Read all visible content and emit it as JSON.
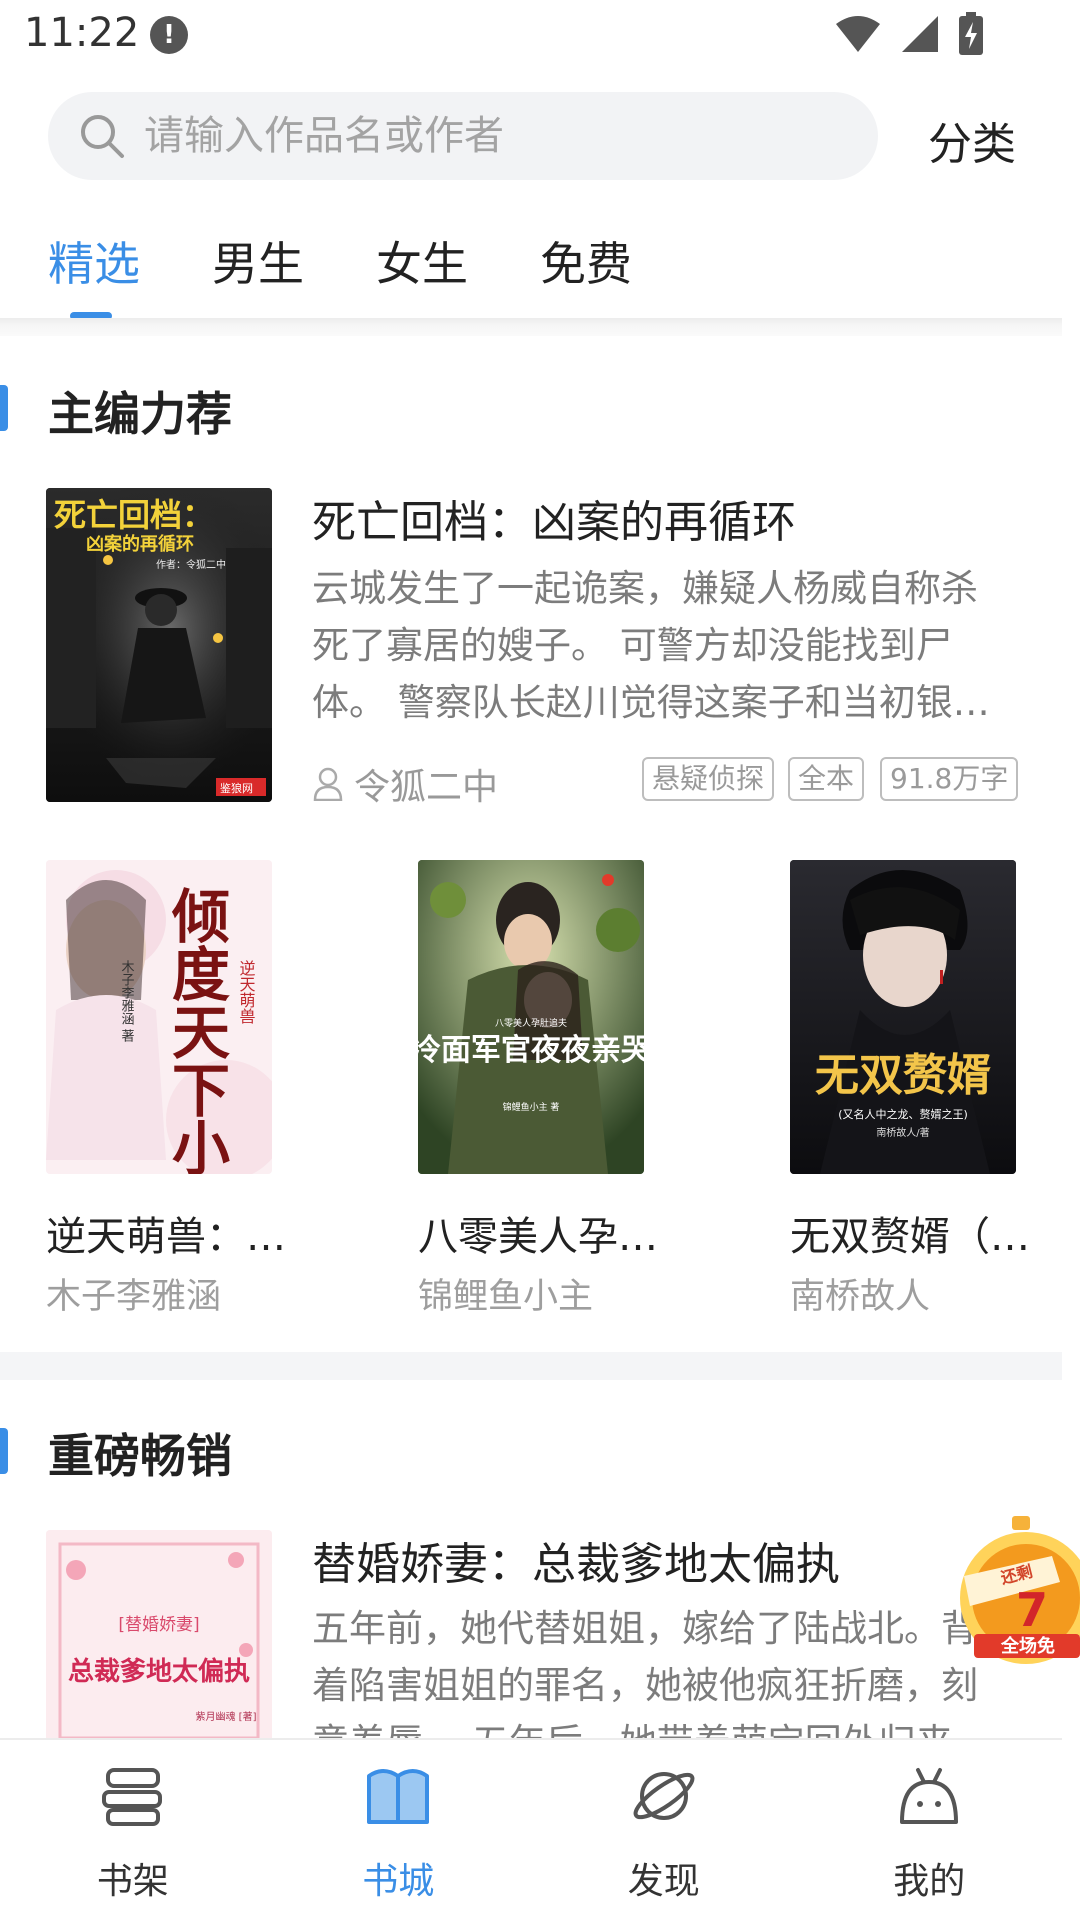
{
  "status_bar": {
    "time": "11:22",
    "alert": "!"
  },
  "search": {
    "placeholder": "请输入作品名或作者",
    "category_label": "分类"
  },
  "tabs": [
    {
      "label": "精选",
      "active": true
    },
    {
      "label": "男生",
      "active": false
    },
    {
      "label": "女生",
      "active": false
    },
    {
      "label": "免费",
      "active": false
    }
  ],
  "section_editor": {
    "title": "主编力荐",
    "featured": {
      "cover_title": "死亡回档：",
      "cover_subtitle": "凶案的再循环",
      "cover_author_line": "作者：令狐二中",
      "cover_logo": "鉴狼网",
      "title": "死亡回档：凶案的再循环",
      "description": "云城发生了一起诡案，嫌疑人杨威自称杀死了寡居的嫂子。 可警方却没能找到尸体。 警察队长赵川觉得这案子和当初银…",
      "author": "令狐二中",
      "tags": [
        "悬疑侦探",
        "全本",
        "91.8万字"
      ]
    },
    "grid": [
      {
        "title": "逆天萌兽：…",
        "author": "木子李雅涵",
        "cover_text": "倾度天下小姐",
        "cover_vertical": "逆天萌兽",
        "cover_author": "木子李雅涵 著"
      },
      {
        "title": "八零美人孕…",
        "author": "锦鲤鱼小主",
        "cover_text": "冷面军官夜夜亲哭",
        "cover_small": "八零美人孕肚追夫",
        "cover_author": "锦鲤鱼小主 著"
      },
      {
        "title": "无双赘婿（…",
        "author": "南桥故人",
        "cover_text": "无双赘婿",
        "cover_sub": "(又名人中之龙、赘婿之王)",
        "cover_author": "南桥故人/著"
      }
    ]
  },
  "section_bestseller": {
    "title": "重磅畅销",
    "item": {
      "title": "替婚娇妻：总裁爹地太偏执",
      "description": "五年前，她代替姐姐，嫁给了陆战北。背着陷害姐姐的罪名，她被他疯狂折磨，刻意羞辱。 五年后，她带着萌宝回外归来",
      "cover_tag": "[替婚娇妻]",
      "cover_text": "总裁爹地太偏执",
      "cover_author": "紫月幽魂 [著]"
    }
  },
  "promo": {
    "top_label": "还剩",
    "number": "7",
    "bottom_label": "全场免"
  },
  "bottom_nav": [
    {
      "label": "书架",
      "icon": "bookshelf-icon",
      "active": false
    },
    {
      "label": "书城",
      "icon": "book-open-icon",
      "active": true
    },
    {
      "label": "发现",
      "icon": "planet-icon",
      "active": false
    },
    {
      "label": "我的",
      "icon": "profile-face-icon",
      "active": false
    }
  ],
  "colors": {
    "accent": "#3a8ee6",
    "muted_text": "#7c7c7c",
    "promo_orange": "#f39a1e"
  }
}
